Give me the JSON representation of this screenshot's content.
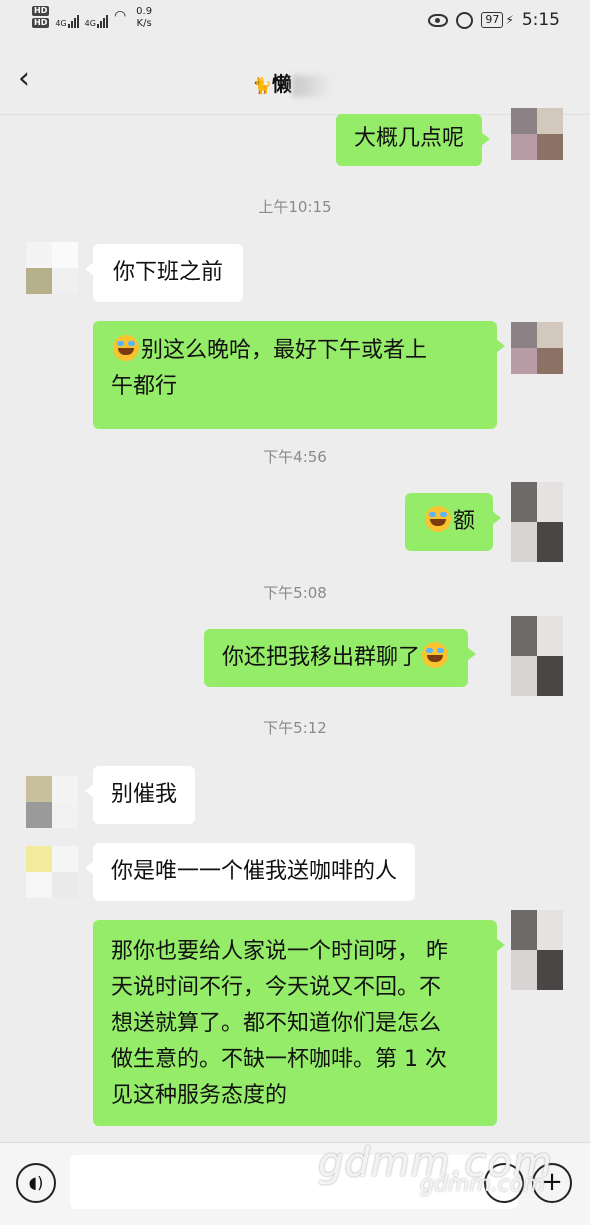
{
  "status_bar": {
    "hd1": "HD",
    "hd2": "HD",
    "net1": "4G",
    "net2": "4G",
    "speed_value": "0.9",
    "speed_unit": "K/s",
    "battery": "97",
    "time": "5:15"
  },
  "chat": {
    "title": "懒"
  },
  "messages": [
    {
      "side": "out",
      "text": "大概几点呢"
    },
    {
      "side": "out",
      "text": "别这么晚哈，最好下午或者上午都行",
      "line1": "别这么晚哈，最好下午或者上",
      "line2": "午都行"
    },
    {
      "side": "out",
      "text": "额"
    },
    {
      "side": "out",
      "text": "你还把我移出群聊了"
    },
    {
      "side": "out",
      "text": "那你也要给人家说一个时间呀， 昨天说时间不行，今天说又不回。不想送就算了。都不知道你们是怎么做生意的。不缺一杯咖啡。第 1 次见这种服务态度的",
      "lines": [
        "那你也要给人家说一个时间呀， 昨",
        "天说时间不行，今天说又不回。不",
        "想送就算了。都不知道你们是怎么",
        "做生意的。不缺一杯咖啡。第 1 次",
        "见这种服务态度的"
      ]
    }
  ],
  "incoming": [
    {
      "side": "in",
      "text": "你下班之前"
    },
    {
      "side": "in",
      "text": "别催我"
    },
    {
      "side": "in",
      "text": "你是唯一一个催我送咖啡的人"
    }
  ],
  "timestamps": [
    "上午10:15",
    "下午4:56",
    "下午5:08",
    "下午5:12"
  ],
  "emoji_icon": "crying-laughing-face",
  "watermark": {
    "big": "gdmm.com",
    "small": "gdmm.com"
  },
  "colors": {
    "outgoing_bubble": "#95ec69",
    "incoming_bubble": "#ffffff",
    "background": "#ededed"
  }
}
